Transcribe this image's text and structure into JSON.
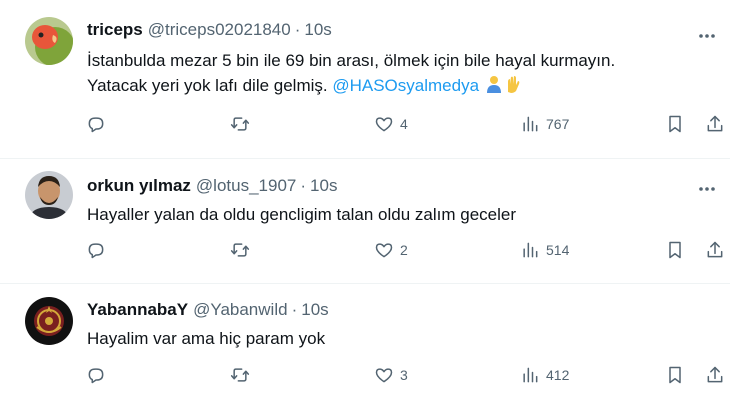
{
  "tweets": [
    {
      "name": "triceps",
      "handle": "@triceps02021840",
      "separator": "·",
      "time": "10s",
      "text_line1": "İstanbulda mezar 5 bin ile 69 bin arası, ölmek için bile hayal kurmayın.",
      "text_line2_prefix": "Yatacak yeri yok lafı dile gelmiş. ",
      "mention": "@HASOsyalmedya",
      "emojis": [
        "person-icon",
        "waving-hands-icon"
      ],
      "likes": "4",
      "views": "767"
    },
    {
      "name": "orkun yılmaz",
      "handle": "@lotus_1907",
      "separator": "·",
      "time": "10s",
      "text": "Hayaller yalan da oldu gencligim talan oldu zalım geceler",
      "likes": "2",
      "views": "514"
    },
    {
      "name": "YabannabaY",
      "handle": "@Yabanwild",
      "separator": "·",
      "time": "10s",
      "text": "Hayalim var ama hiç param yok",
      "likes": "3",
      "views": "412"
    }
  ],
  "colors": {
    "text": "#0f1419",
    "secondary": "#536471",
    "mention": "#1d9bf0",
    "divider": "#eff3f4"
  },
  "icons": [
    "reply-icon",
    "retweet-icon",
    "like-icon",
    "views-icon",
    "bookmark-icon",
    "share-icon",
    "more-icon"
  ]
}
